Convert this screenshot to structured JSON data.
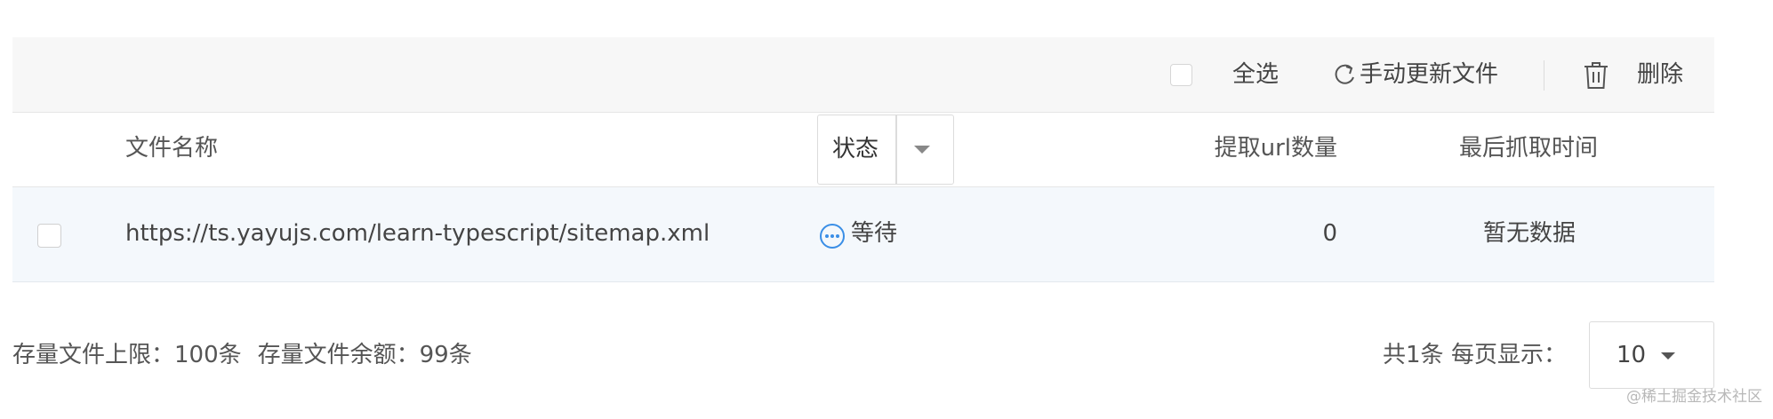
{
  "toolbar": {
    "select_all_label": "全选",
    "refresh_label": "手动更新文件",
    "delete_label": "删除"
  },
  "table": {
    "headers": {
      "filename": "文件名称",
      "status": "状态",
      "url_count": "提取url数量",
      "last_fetch_time": "最后抓取时间"
    },
    "rows": [
      {
        "filename": "https://ts.yayujs.com/learn-typescript/sitemap.xml",
        "status": "等待",
        "url_count": "0",
        "last_fetch_time": "暂无数据"
      }
    ]
  },
  "footer": {
    "storage_limit": "存量文件上限：100条",
    "storage_remaining": "存量文件余额：99条",
    "total": "共1条",
    "per_page_label": "每页显示：",
    "page_size": "10"
  },
  "watermark": "@稀土掘金技术社区",
  "colors": {
    "toolbar_bg": "#f7f7f7",
    "row_bg": "#f4f8fc",
    "status_icon": "#3a8ee6"
  }
}
